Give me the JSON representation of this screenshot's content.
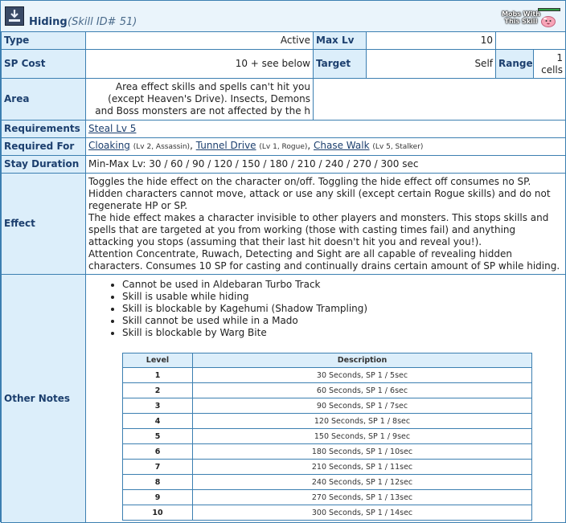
{
  "header": {
    "title": "Hiding",
    "skill_id": "(Skill ID# 51)",
    "mobs_label_line1": "Mobs With",
    "mobs_label_line2": "This Skill"
  },
  "rows": {
    "type_label": "Type",
    "type_value": "Active",
    "max_lv_label": "Max Lv",
    "max_lv_value": "10",
    "sp_cost_label": "SP Cost",
    "sp_cost_value": "10 + see below",
    "target_label": "Target",
    "target_value": "Self",
    "range_label": "Range",
    "range_value_line1": "1",
    "range_value_line2": "cells",
    "area_label": "Area",
    "area_line1": "Area effect skills and spells can't hit you",
    "area_line2": "(except Heaven's Drive). Insects, Demons",
    "area_line3": "and Boss monsters are not affected by the h",
    "requirements_label": "Requirements",
    "requirements_link": "Steal Lv 5",
    "required_for_label": "Required For",
    "required_for": [
      {
        "link": "Cloaking",
        "note": "(Lv 2, Assassin)"
      },
      {
        "link": "Tunnel Drive",
        "note": "(Lv 1, Rogue)"
      },
      {
        "link": "Chase Walk",
        "note": "(Lv 5, Stalker)"
      }
    ],
    "stay_duration_label": "Stay Duration",
    "stay_duration_value": "Min-Max Lv: 30 / 60 / 90 / 120 / 150 / 180 / 210 / 240 / 270 / 300 sec",
    "effect_label": "Effect",
    "effect_lines": [
      "Toggles the hide effect on the character on/off. Toggling the hide effect off consumes no SP.",
      "Hidden characters cannot move, attack or use any skill (except certain Rogue skills) and do not regenerate HP or SP.",
      "The hide effect makes a character invisible to other players and monsters. This stops skills and spells that are targeted at you from working (those with casting times fail) and anything attacking you stops (assuming that their last hit doesn't hit you and reveal you!).",
      "Attention Concentrate, Ruwach, Detecting and Sight are all capable of revealing hidden characters. Consumes 10 SP for casting and continually drains certain amount of SP while hiding."
    ],
    "other_notes_label": "Other Notes",
    "notes": [
      "Cannot be used in Aldebaran Turbo Track",
      "Skill is usable while hiding",
      "Skill is blockable by Kagehumi (Shadow Trampling)",
      "Skill cannot be used while in a Mado",
      "Skill is blockable by Warg Bite"
    ]
  },
  "level_table": {
    "col_level": "Level",
    "col_description": "Description",
    "rows": [
      {
        "level": "1",
        "desc": "30 Seconds, SP 1 / 5sec"
      },
      {
        "level": "2",
        "desc": "60 Seconds, SP 1 / 6sec"
      },
      {
        "level": "3",
        "desc": "90 Seconds, SP 1 / 7sec"
      },
      {
        "level": "4",
        "desc": "120 Seconds, SP 1 / 8sec"
      },
      {
        "level": "5",
        "desc": "150 Seconds, SP 1 / 9sec"
      },
      {
        "level": "6",
        "desc": "180 Seconds, SP 1 / 10sec"
      },
      {
        "level": "7",
        "desc": "210 Seconds, SP 1 / 11sec"
      },
      {
        "level": "8",
        "desc": "240 Seconds, SP 1 / 12sec"
      },
      {
        "level": "9",
        "desc": "270 Seconds, SP 1 / 13sec"
      },
      {
        "level": "10",
        "desc": "300 Seconds, SP 1 / 14sec"
      }
    ]
  },
  "colors": {
    "border": "#3c7fb1",
    "header_bg": "#dceefa",
    "panel_bg": "#eaf4fb",
    "header_text": "#1c3f6e"
  },
  "icons": {
    "skill": "hiding-skill-icon",
    "mobs": "poring-icon"
  }
}
